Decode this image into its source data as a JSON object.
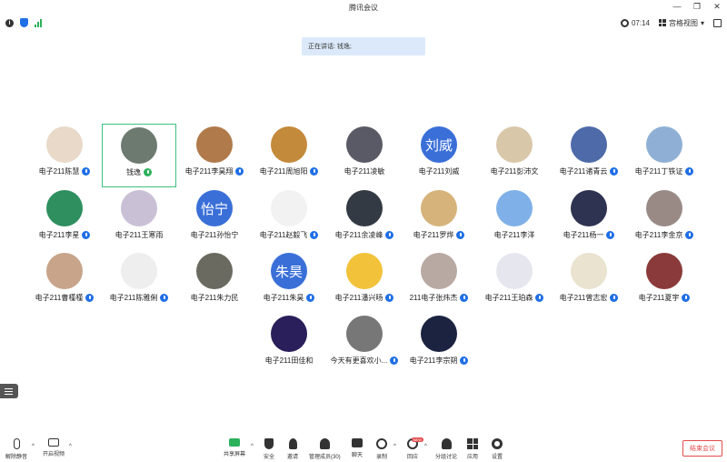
{
  "window": {
    "title": "腾讯会议"
  },
  "status": {
    "timer": "07:14",
    "view_label": "宫格视图"
  },
  "speaking": {
    "text": "正在讲话: 钱逸;"
  },
  "participants": [
    {
      "name": "电子211陈慧",
      "mic": "blue"
    },
    {
      "name": "钱逸",
      "mic": "green"
    },
    {
      "name": "电子211李昊翔",
      "mic": "blue"
    },
    {
      "name": "电子211周旭阳",
      "mic": "blue"
    },
    {
      "name": "电子211凌敏",
      "mic": "none"
    },
    {
      "name": "电子211刘威",
      "mic": "none",
      "avatar_text": "刘威"
    },
    {
      "name": "电子211彭沛文",
      "mic": "none"
    },
    {
      "name": "电子211诸青云",
      "mic": "blue"
    },
    {
      "name": "电子211丁铁证",
      "mic": "blue"
    },
    {
      "name": "电子211李星",
      "mic": "blue"
    },
    {
      "name": "电子211王寒雨",
      "mic": "none"
    },
    {
      "name": "电子211孙怡宁",
      "mic": "none",
      "avatar_text": "怡宁"
    },
    {
      "name": "电子211赵毅飞",
      "mic": "blue"
    },
    {
      "name": "电子211余凌峰",
      "mic": "blue"
    },
    {
      "name": "电子211罗烨",
      "mic": "blue"
    },
    {
      "name": "电子211李洋",
      "mic": "none"
    },
    {
      "name": "电子211杨一",
      "mic": "blue"
    },
    {
      "name": "电子211李金京",
      "mic": "blue"
    },
    {
      "name": "电子211曹槿槿",
      "mic": "blue"
    },
    {
      "name": "电子211陈雅俐",
      "mic": "blue"
    },
    {
      "name": "电子211朱力民",
      "mic": "none"
    },
    {
      "name": "电子211朱昊",
      "mic": "blue",
      "avatar_text": "朱昊"
    },
    {
      "name": "电子211潘兴旸",
      "mic": "blue"
    },
    {
      "name": "211电子张炜杰",
      "mic": "blue"
    },
    {
      "name": "电子211王珀森",
      "mic": "blue"
    },
    {
      "name": "电子211曾志宏",
      "mic": "blue"
    },
    {
      "name": "电子211夏宇",
      "mic": "blue"
    },
    {
      "name": "电子211田佳和",
      "mic": "none"
    },
    {
      "name": "今天有更喜欢小...",
      "mic": "blue"
    },
    {
      "name": "电子211李宗朔",
      "mic": "blue"
    }
  ],
  "toolbar": {
    "unmute": "解除静音",
    "start_video": "开启视频",
    "share": "共享屏幕",
    "security": "安全",
    "invite": "邀请",
    "members": "管理成员(30)",
    "chat": "聊天",
    "record": "录制",
    "reactions": "回应",
    "breakout": "分组讨论",
    "apps": "应用",
    "settings": "设置",
    "end": "结束会议",
    "new_badge": "NEW"
  },
  "colors": {
    "accent": "#1f6fe5",
    "active_border": "#3fbf7f",
    "end": "#e24b4b"
  }
}
